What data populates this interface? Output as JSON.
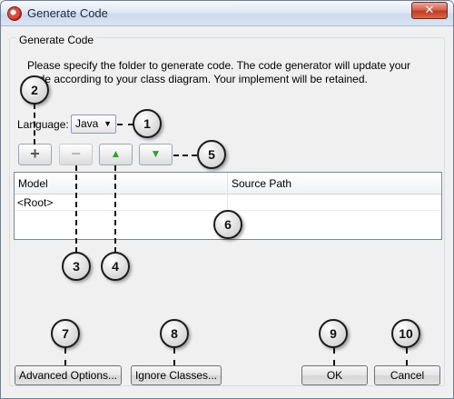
{
  "window": {
    "title": "Generate Code",
    "close_label": "✕"
  },
  "group": {
    "legend": "Generate Code",
    "instructions": "Please specify the folder to generate code. The code generator will update your code according to your class diagram. Your implement will be retained."
  },
  "language": {
    "label": "Language:",
    "selected": "Java",
    "dropdown_glyph": "▼"
  },
  "toolbar": {
    "add": "+",
    "remove": "−",
    "move_up": "▲",
    "move_down": "▼"
  },
  "table": {
    "columns": [
      "Model",
      "Source Path"
    ],
    "rows": [
      [
        "<Root>",
        ""
      ]
    ]
  },
  "buttons": {
    "advanced": "Advanced Options...",
    "ignore": "Ignore Classes...",
    "ok": "OK",
    "cancel": "Cancel"
  },
  "callouts": [
    "1",
    "2",
    "3",
    "4",
    "5",
    "6",
    "7",
    "8",
    "9",
    "10"
  ],
  "icons": {
    "app": "app-logo-icon",
    "add": "plus-icon",
    "remove": "minus-icon",
    "up": "arrow-up-icon",
    "down": "arrow-down-icon"
  },
  "colors": {
    "accent_green": "#2da32b",
    "close_red": "#c23a22"
  }
}
